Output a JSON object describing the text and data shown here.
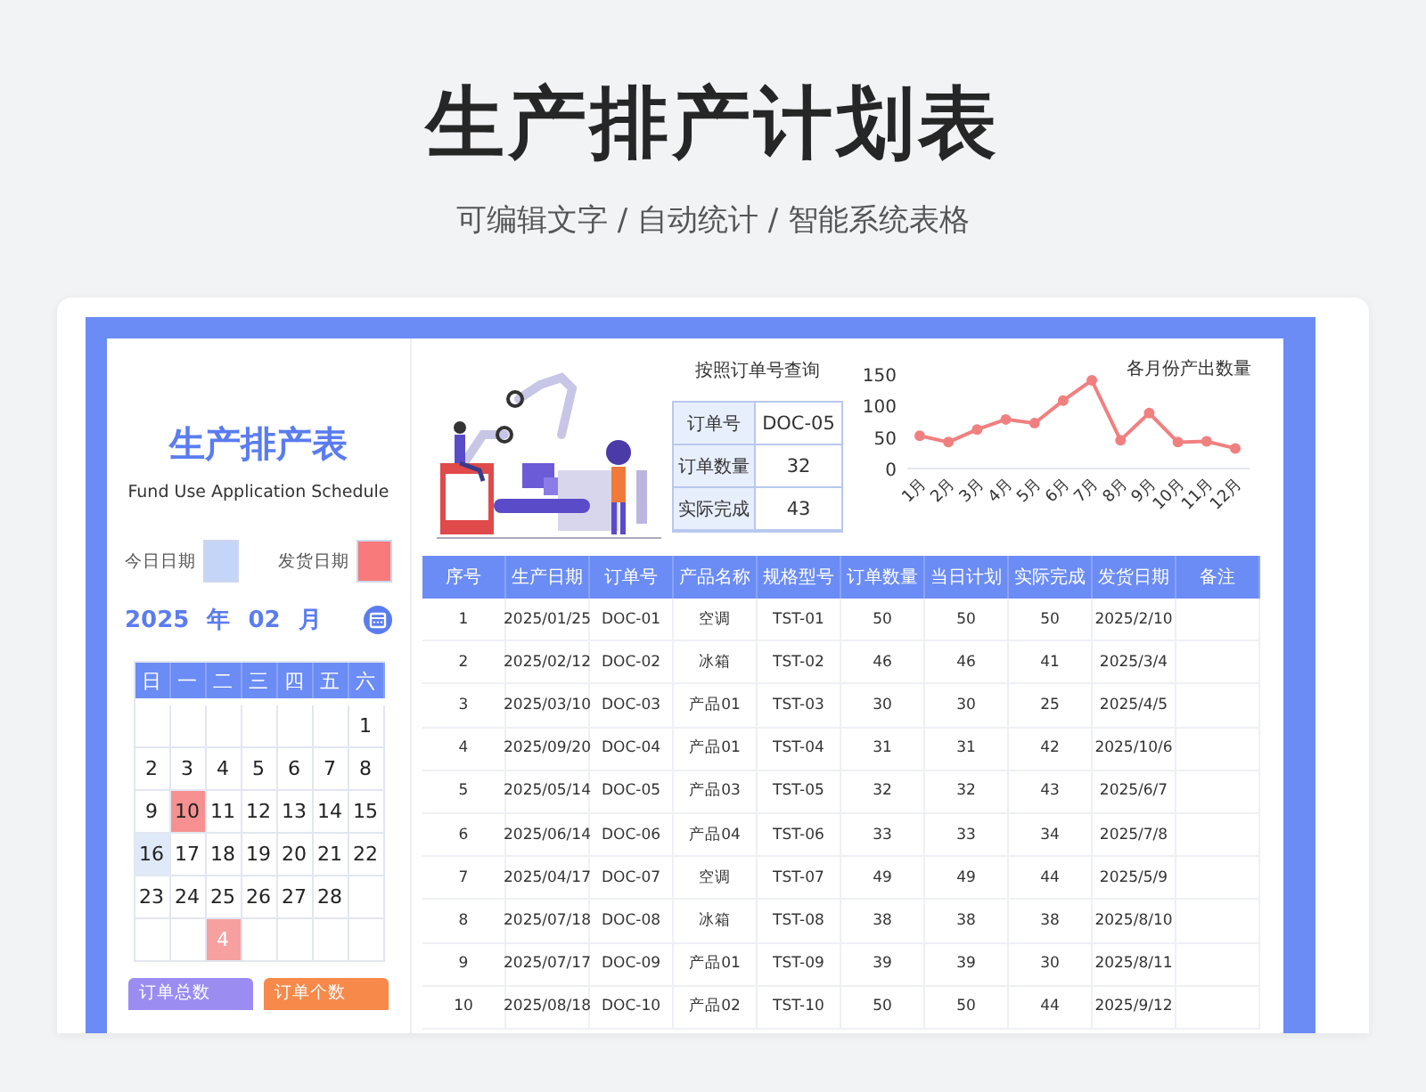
{
  "header": {
    "title": "生产排产计划表",
    "subtitle": "可编辑文字 / 自动统计 / 智能系统表格"
  },
  "sidebar": {
    "title": "生产排产表",
    "subtitle": "Fund Use Application Schedule",
    "legend": [
      {
        "label": "今日日期",
        "color": "#c5d5f7"
      },
      {
        "label": "发货日期",
        "color": "#f87a7a"
      }
    ],
    "year": "2025",
    "year_unit": "年",
    "month": "02",
    "month_unit": "月",
    "weekdays": [
      "日",
      "一",
      "二",
      "三",
      "四",
      "五",
      "六"
    ],
    "weeks": [
      [
        {
          "kind": "blank"
        },
        {
          "kind": "blank"
        },
        {
          "kind": "blank"
        },
        {
          "kind": "blank"
        },
        {
          "kind": "blank"
        },
        {
          "kind": "blank"
        },
        {
          "kind": "day",
          "day": "1"
        }
      ],
      [
        {
          "kind": "day",
          "day": "2"
        },
        {
          "kind": "day",
          "day": "3"
        },
        {
          "kind": "day",
          "day": "4"
        },
        {
          "kind": "day",
          "day": "5"
        },
        {
          "kind": "day",
          "day": "6"
        },
        {
          "kind": "day",
          "day": "7"
        },
        {
          "kind": "day",
          "day": "8"
        }
      ],
      [
        {
          "kind": "day",
          "day": "9"
        },
        {
          "kind": "ship",
          "day": "10"
        },
        {
          "kind": "day",
          "day": "11"
        },
        {
          "kind": "day",
          "day": "12"
        },
        {
          "kind": "day",
          "day": "13"
        },
        {
          "kind": "day",
          "day": "14"
        },
        {
          "kind": "day",
          "day": "15"
        }
      ],
      [
        {
          "kind": "today",
          "day": "16"
        },
        {
          "kind": "day",
          "day": "17"
        },
        {
          "kind": "day",
          "day": "18"
        },
        {
          "kind": "day",
          "day": "19"
        },
        {
          "kind": "day",
          "day": "20"
        },
        {
          "kind": "day",
          "day": "21"
        },
        {
          "kind": "day",
          "day": "22"
        }
      ],
      [
        {
          "kind": "day",
          "day": "23"
        },
        {
          "kind": "day",
          "day": "24"
        },
        {
          "kind": "day",
          "day": "25"
        },
        {
          "kind": "day",
          "day": "26"
        },
        {
          "kind": "day",
          "day": "27"
        },
        {
          "kind": "day",
          "day": "28"
        },
        {
          "kind": "blank"
        }
      ],
      [
        {
          "kind": "blank"
        },
        {
          "kind": "blank"
        },
        {
          "kind": "count",
          "day": "4"
        },
        {
          "kind": "blank"
        },
        {
          "kind": "blank"
        },
        {
          "kind": "blank"
        },
        {
          "kind": "blank"
        }
      ]
    ],
    "stat_cards": [
      {
        "label": "订单总数",
        "color": "#9b8cf2"
      },
      {
        "label": "订单个数",
        "color": "#f7894a"
      }
    ]
  },
  "lookup": {
    "title": "按照订单号查询",
    "rows": [
      {
        "label": "订单号",
        "value": "DOC-05"
      },
      {
        "label": "订单数量",
        "value": "32"
      },
      {
        "label": "实际完成",
        "value": "43"
      }
    ]
  },
  "chart": {
    "chart_data": {
      "type": "line",
      "title": "各月份产出数量",
      "categories": [
        "1月",
        "2月",
        "3月",
        "4月",
        "5月",
        "6月",
        "7月",
        "8月",
        "9月",
        "10月",
        "11月",
        "12月"
      ],
      "series": [
        {
          "color": "#f08080",
          "marker": "circle",
          "values": [
            52,
            42,
            62,
            78,
            72,
            108,
            140,
            45,
            88,
            42,
            43,
            32
          ]
        }
      ],
      "ylim": [
        0,
        150
      ],
      "yticks": [
        0,
        50,
        100,
        150
      ]
    }
  },
  "table": {
    "columns": [
      "序号",
      "生产日期",
      "订单号",
      "产品名称",
      "规格型号",
      "订单数量",
      "当日计划",
      "实际完成",
      "发货日期",
      "备注"
    ],
    "rows": [
      [
        "1",
        "2025/01/25",
        "DOC-01",
        "空调",
        "TST-01",
        "50",
        "50",
        "50",
        "2025/2/10"
      ],
      [
        "2",
        "2025/02/12",
        "DOC-02",
        "冰箱",
        "TST-02",
        "46",
        "46",
        "41",
        "2025/3/4"
      ],
      [
        "3",
        "2025/03/10",
        "DOC-03",
        "产品01",
        "TST-03",
        "30",
        "30",
        "25",
        "2025/4/5"
      ],
      [
        "4",
        "2025/09/20",
        "DOC-04",
        "产品01",
        "TST-04",
        "31",
        "31",
        "42",
        "2025/10/6"
      ],
      [
        "5",
        "2025/05/14",
        "DOC-05",
        "产品03",
        "TST-05",
        "32",
        "32",
        "43",
        "2025/6/7"
      ],
      [
        "6",
        "2025/06/14",
        "DOC-06",
        "产品04",
        "TST-06",
        "33",
        "33",
        "34",
        "2025/7/8"
      ],
      [
        "7",
        "2025/04/17",
        "DOC-07",
        "空调",
        "TST-07",
        "49",
        "49",
        "44",
        "2025/5/9"
      ],
      [
        "8",
        "2025/07/18",
        "DOC-08",
        "冰箱",
        "TST-08",
        "38",
        "38",
        "38",
        "2025/8/10"
      ],
      [
        "9",
        "2025/07/17",
        "DOC-09",
        "产品01",
        "TST-09",
        "39",
        "39",
        "30",
        "2025/8/11"
      ],
      [
        "10",
        "2025/08/18",
        "DOC-10",
        "产品02",
        "TST-10",
        "50",
        "50",
        "44",
        "2025/9/12"
      ]
    ]
  }
}
